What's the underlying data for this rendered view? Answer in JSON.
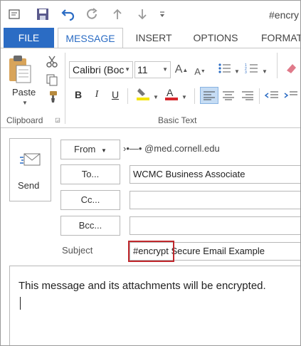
{
  "window": {
    "title": "#encry"
  },
  "qat": {
    "icons": [
      "outlook-window-icon",
      "save-icon",
      "undo-icon",
      "redo-icon",
      "up-arrow-icon",
      "down-arrow-icon",
      "customize-icon"
    ]
  },
  "tabs": [
    {
      "label": "FILE"
    },
    {
      "label": "MESSAGE",
      "active": true
    },
    {
      "label": "INSERT"
    },
    {
      "label": "OPTIONS"
    },
    {
      "label": "FORMAT"
    }
  ],
  "ribbon": {
    "clipboard": {
      "paste_label": "Paste",
      "group_label": "Clipboard"
    },
    "basic_text": {
      "font_name": "Calibri (Boc",
      "font_size": "11",
      "bold": "B",
      "italic": "I",
      "underline": "U",
      "group_label": "Basic Text"
    }
  },
  "compose": {
    "send_label": "Send",
    "from": {
      "label": "From",
      "value": "›•—• @med.cornell.edu"
    },
    "to": {
      "label": "To...",
      "value": "WCMC Business Associate"
    },
    "cc": {
      "label": "Cc...",
      "value": ""
    },
    "bcc": {
      "label": "Bcc...",
      "value": ""
    },
    "subject": {
      "label": "Subject",
      "value": "#encrypt Secure Email Example"
    },
    "body": "This message and its attachments will be encrypted."
  },
  "colors": {
    "accent": "#2b6cc4",
    "highlight_border": "#c0282d",
    "highlighter_yellow": "#f5e400",
    "font_color_red": "#d6262b"
  }
}
